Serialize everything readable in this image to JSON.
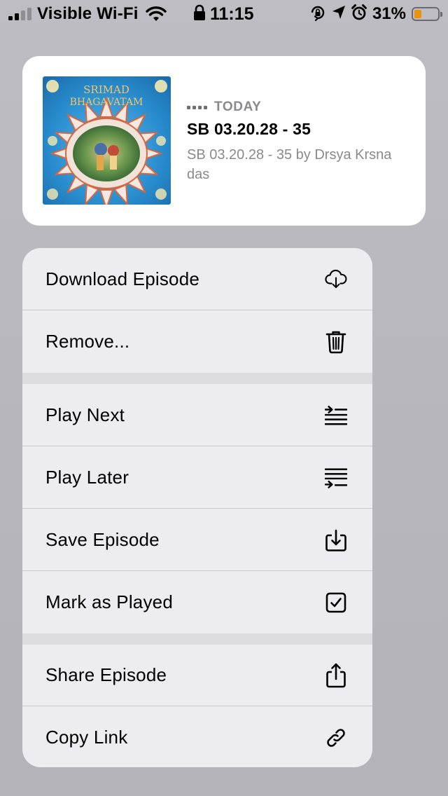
{
  "status_bar": {
    "carrier": "Visible Wi-Fi",
    "time": "11:15",
    "battery_percent": "31%",
    "battery_level": 0.31,
    "battery_color": "#e8940c",
    "icons": [
      "signal-icon",
      "wifi-icon",
      "lock-icon",
      "orientation-lock-icon",
      "location-icon",
      "alarm-icon",
      "battery-icon"
    ]
  },
  "episode": {
    "date": "TODAY",
    "title": "SB 03.20.28 - 35",
    "description": "SB 03.20.28 - 35 by Drsya Krsna das",
    "artwork_text_line1": "SRIMAD",
    "artwork_text_line2": "BHAGAVATAM"
  },
  "menu": {
    "items": [
      {
        "label": "Download Episode",
        "icon": "cloud-download-icon"
      },
      {
        "label": "Remove...",
        "icon": "trash-icon"
      },
      {
        "label": "Play Next",
        "icon": "play-next-icon"
      },
      {
        "label": "Play Later",
        "icon": "play-later-icon"
      },
      {
        "label": "Save Episode",
        "icon": "save-tray-icon"
      },
      {
        "label": "Mark as Played",
        "icon": "checkbox-icon"
      },
      {
        "label": "Share Episode",
        "icon": "share-icon"
      },
      {
        "label": "Copy Link",
        "icon": "link-icon"
      }
    ]
  }
}
